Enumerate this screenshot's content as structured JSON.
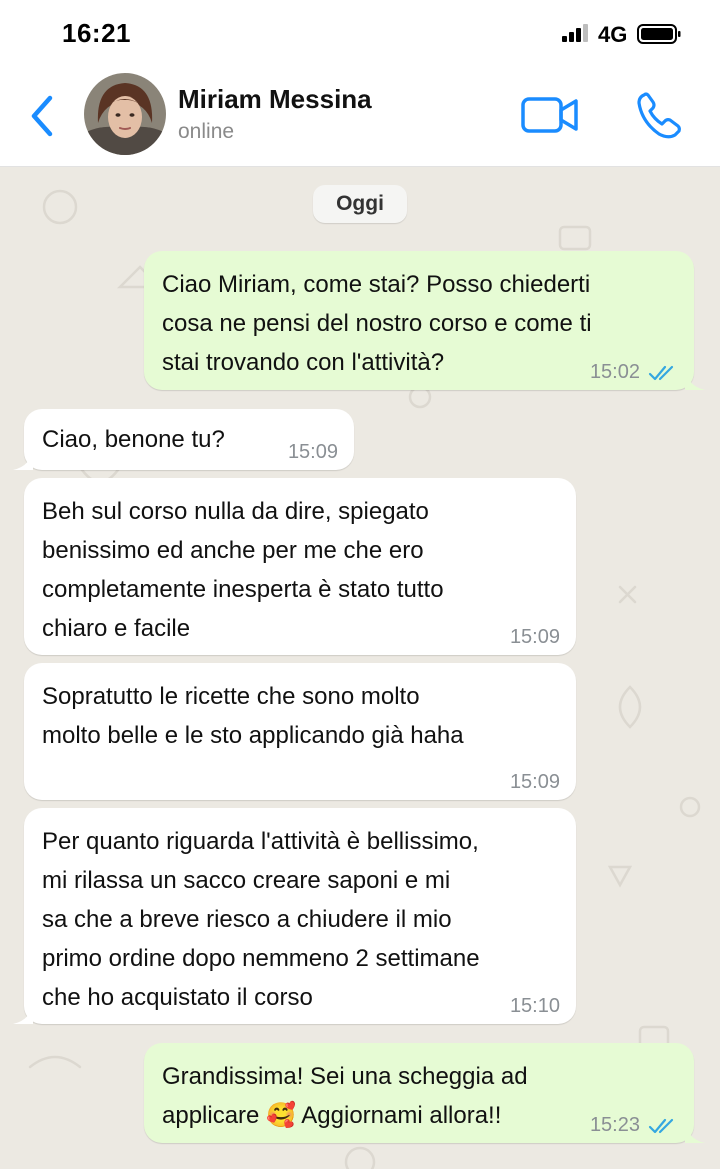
{
  "status_bar": {
    "time": "16:21",
    "network": "4G"
  },
  "header": {
    "contact_name": "Miriam Messina",
    "contact_status": "online"
  },
  "chat": {
    "date_separator": "Oggi",
    "messages": [
      {
        "direction": "outgoing",
        "text": "Ciao Miriam, come stai? Posso chiederti\ncosa ne pensi del nostro corso e come ti\nstai trovando con l'attività?",
        "time": "15:02",
        "status": "read"
      },
      {
        "direction": "incoming",
        "text": "Ciao, benone tu?",
        "time": "15:09"
      },
      {
        "direction": "incoming",
        "text": "Beh sul corso nulla da dire, spiegato\nbenissimo ed anche per me che ero\ncompletamente inesperta è stato tutto\nchiaro e facile",
        "time": "15:09"
      },
      {
        "direction": "incoming",
        "text": "Sopratutto le ricette che sono molto\nmolto belle e le sto applicando già haha",
        "time": "15:09"
      },
      {
        "direction": "incoming",
        "text": "Per quanto riguarda l'attività è bellissimo,\nmi rilassa un sacco creare saponi e mi\nsa che a breve riesco a chiudere il mio\nprimo ordine dopo nemmeno 2 settimane\nche ho acquistato il corso",
        "time": "15:10"
      },
      {
        "direction": "outgoing",
        "text": "Grandissima! Sei una scheggia ad\napplicare 🥰 Aggiornami allora!!",
        "time": "15:23",
        "status": "read"
      }
    ]
  },
  "colors": {
    "accent": "#1a8cff",
    "outgoing_bubble": "#e6fbd4",
    "incoming_bubble": "#ffffff",
    "chat_background": "#ece9e2",
    "read_ticks": "#34a7e0"
  },
  "icons": [
    "back-chevron-icon",
    "video-call-icon",
    "phone-call-icon",
    "read-ticks-icon",
    "signal-icon",
    "battery-icon"
  ]
}
